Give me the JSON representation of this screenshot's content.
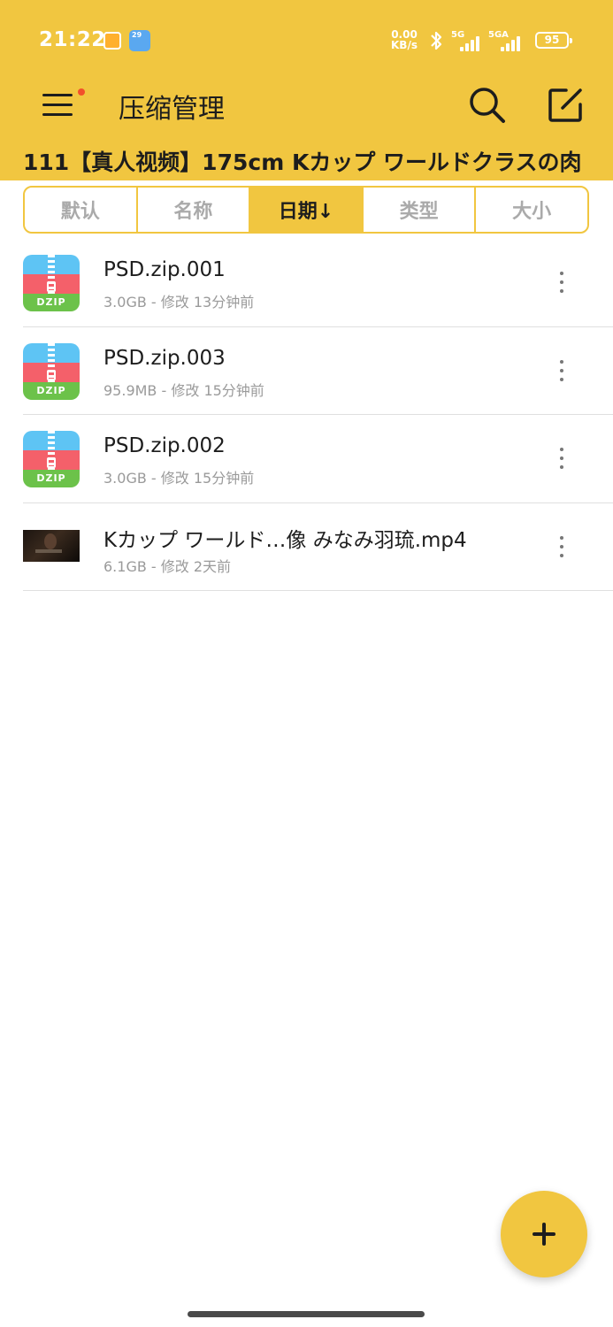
{
  "status_bar": {
    "time": "21:22",
    "weather_badge": "29",
    "net_speed_value": "0.00",
    "net_speed_unit": "KB/s",
    "signal1_label": "5G",
    "signal2_label": "5GA",
    "battery": "95"
  },
  "app_bar": {
    "title": "压缩管理",
    "menu_icon": "hamburger-menu-icon",
    "search_icon": "search-icon",
    "edit_icon": "edit-icon"
  },
  "path": "111【真人视频】175cm Kカップ ワールドクラスの肉",
  "sort_tabs": [
    {
      "label": "默认"
    },
    {
      "label": "名称"
    },
    {
      "label": "日期↓"
    },
    {
      "label": "类型"
    },
    {
      "label": "大小"
    }
  ],
  "files": [
    {
      "name": "PSD.zip.001",
      "meta": "3.0GB - 修改 13分钟前",
      "thumb_label": "DZIP"
    },
    {
      "name": "PSD.zip.003",
      "meta": "95.9MB - 修改 15分钟前",
      "thumb_label": "DZIP"
    },
    {
      "name": "PSD.zip.002",
      "meta": "3.0GB - 修改 15分钟前",
      "thumb_label": "DZIP"
    },
    {
      "name": "Kカップ ワールド…像 みなみ羽琉.mp4",
      "meta": "6.1GB - 修改 2天前"
    }
  ],
  "colors": {
    "accent": "#f1c640",
    "text": "#1d1d1d",
    "muted": "#9a9a9a",
    "notification_dot": "#f2502b"
  },
  "fab_icon": "plus-icon"
}
